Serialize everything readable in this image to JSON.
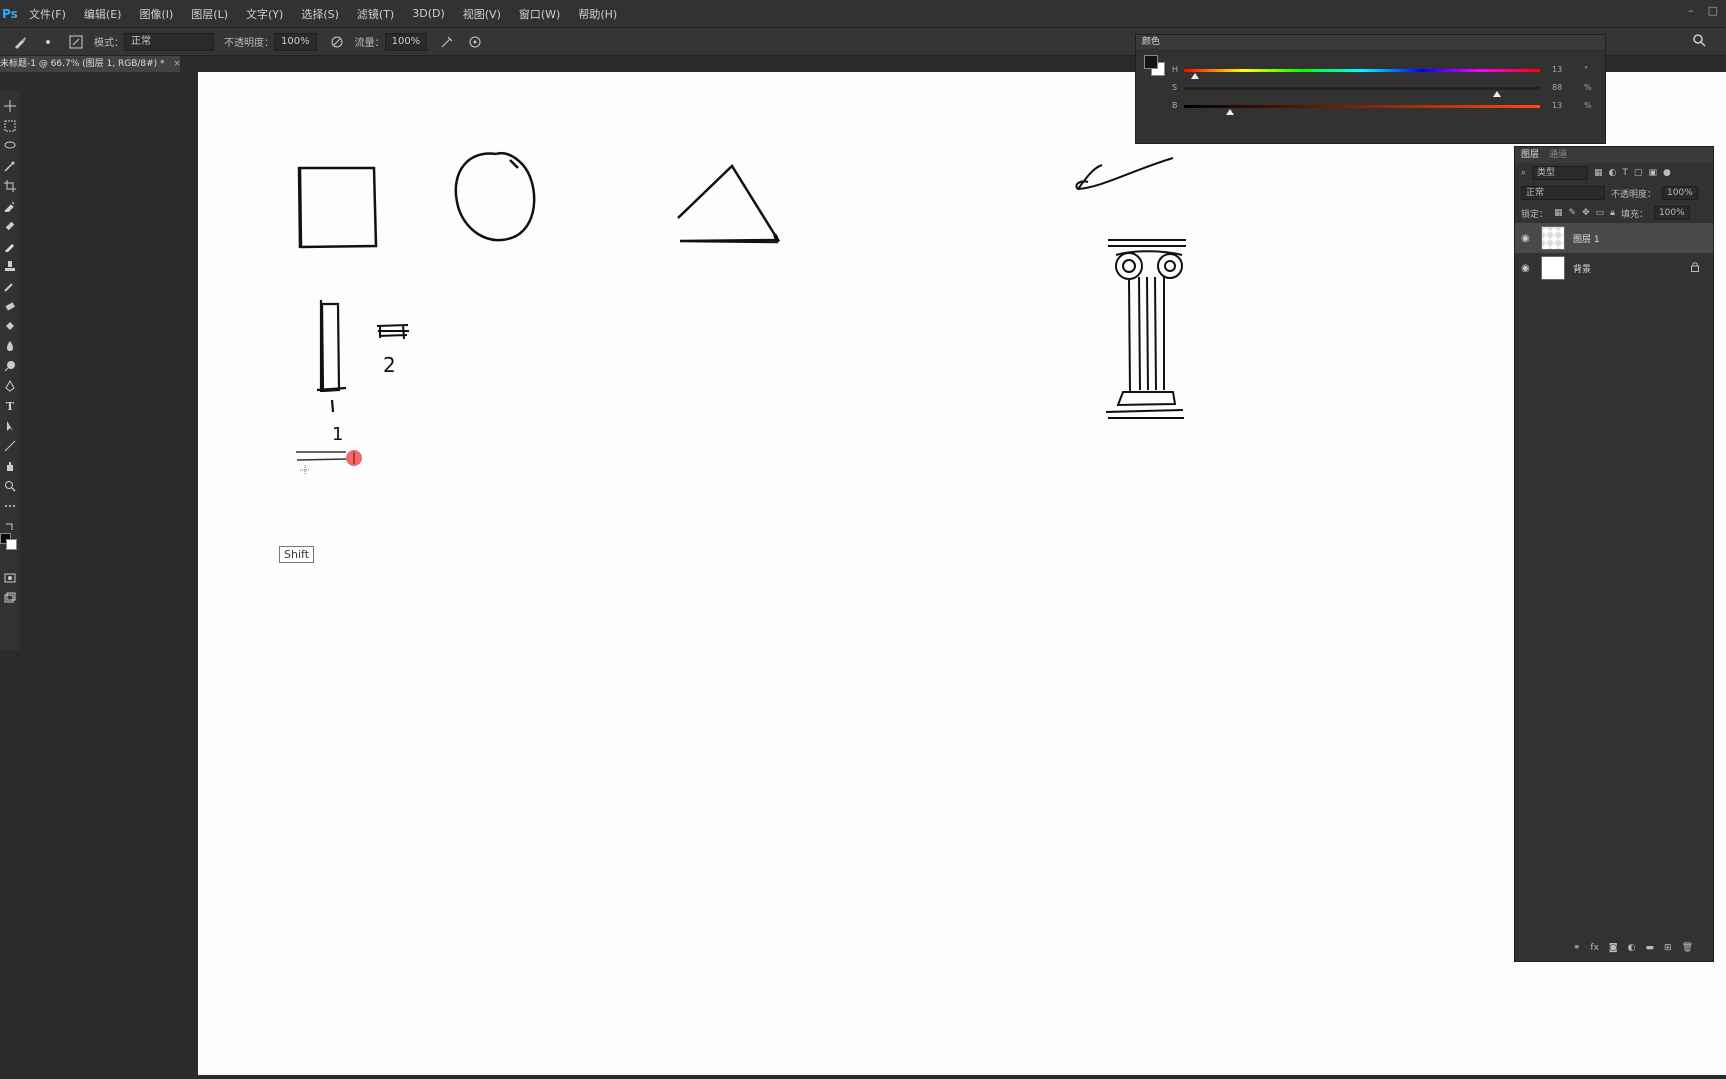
{
  "menubar": {
    "logo": "Ps",
    "items": [
      "文件(F)",
      "编辑(E)",
      "图像(I)",
      "图层(L)",
      "文字(Y)",
      "选择(S)",
      "滤镜(T)",
      "3D(D)",
      "视图(V)",
      "窗口(W)",
      "帮助(H)"
    ],
    "window_controls": [
      "–",
      "□"
    ]
  },
  "optbar": {
    "mode_label": "模式：",
    "mode_value": "正常",
    "opacity_label": "不透明度：",
    "opacity_value": "100%",
    "flow_label": "流量：",
    "flow_value": "100%"
  },
  "doc_tab": {
    "title": "未标题-1 @ 66.7% (图层 1, RGB/8#) *",
    "close": "×"
  },
  "canvas": {
    "sketch_labels": {
      "num_1": "1",
      "num_2": "2"
    },
    "tooltip": "Shift"
  },
  "color_panel": {
    "title": "颜色",
    "sliders": [
      {
        "label": "H",
        "value": "13",
        "unit": "°",
        "fraction": 0.04
      },
      {
        "label": "S",
        "value": "88",
        "unit": "%",
        "fraction": 0.88
      },
      {
        "label": "B",
        "value": "13",
        "unit": "%",
        "fraction": 0.13
      }
    ]
  },
  "layers_panel": {
    "tabs": [
      "图层",
      "通道"
    ],
    "filter_label": "类型",
    "blend_mode": "正常",
    "opacity_label": "不透明度：",
    "opacity_value": "100%",
    "lock_label": "锁定：",
    "fill_label": "填充：",
    "fill_value": "100%",
    "layers": [
      {
        "name": "图层 1",
        "active": true,
        "transparent": true
      },
      {
        "name": "背景",
        "active": false,
        "transparent": false,
        "locked": true
      }
    ],
    "footer_icons": [
      "link-icon",
      "fx-icon",
      "mask-icon",
      "adjustment-icon",
      "folder-icon",
      "new-layer-icon",
      "trash-icon"
    ]
  }
}
